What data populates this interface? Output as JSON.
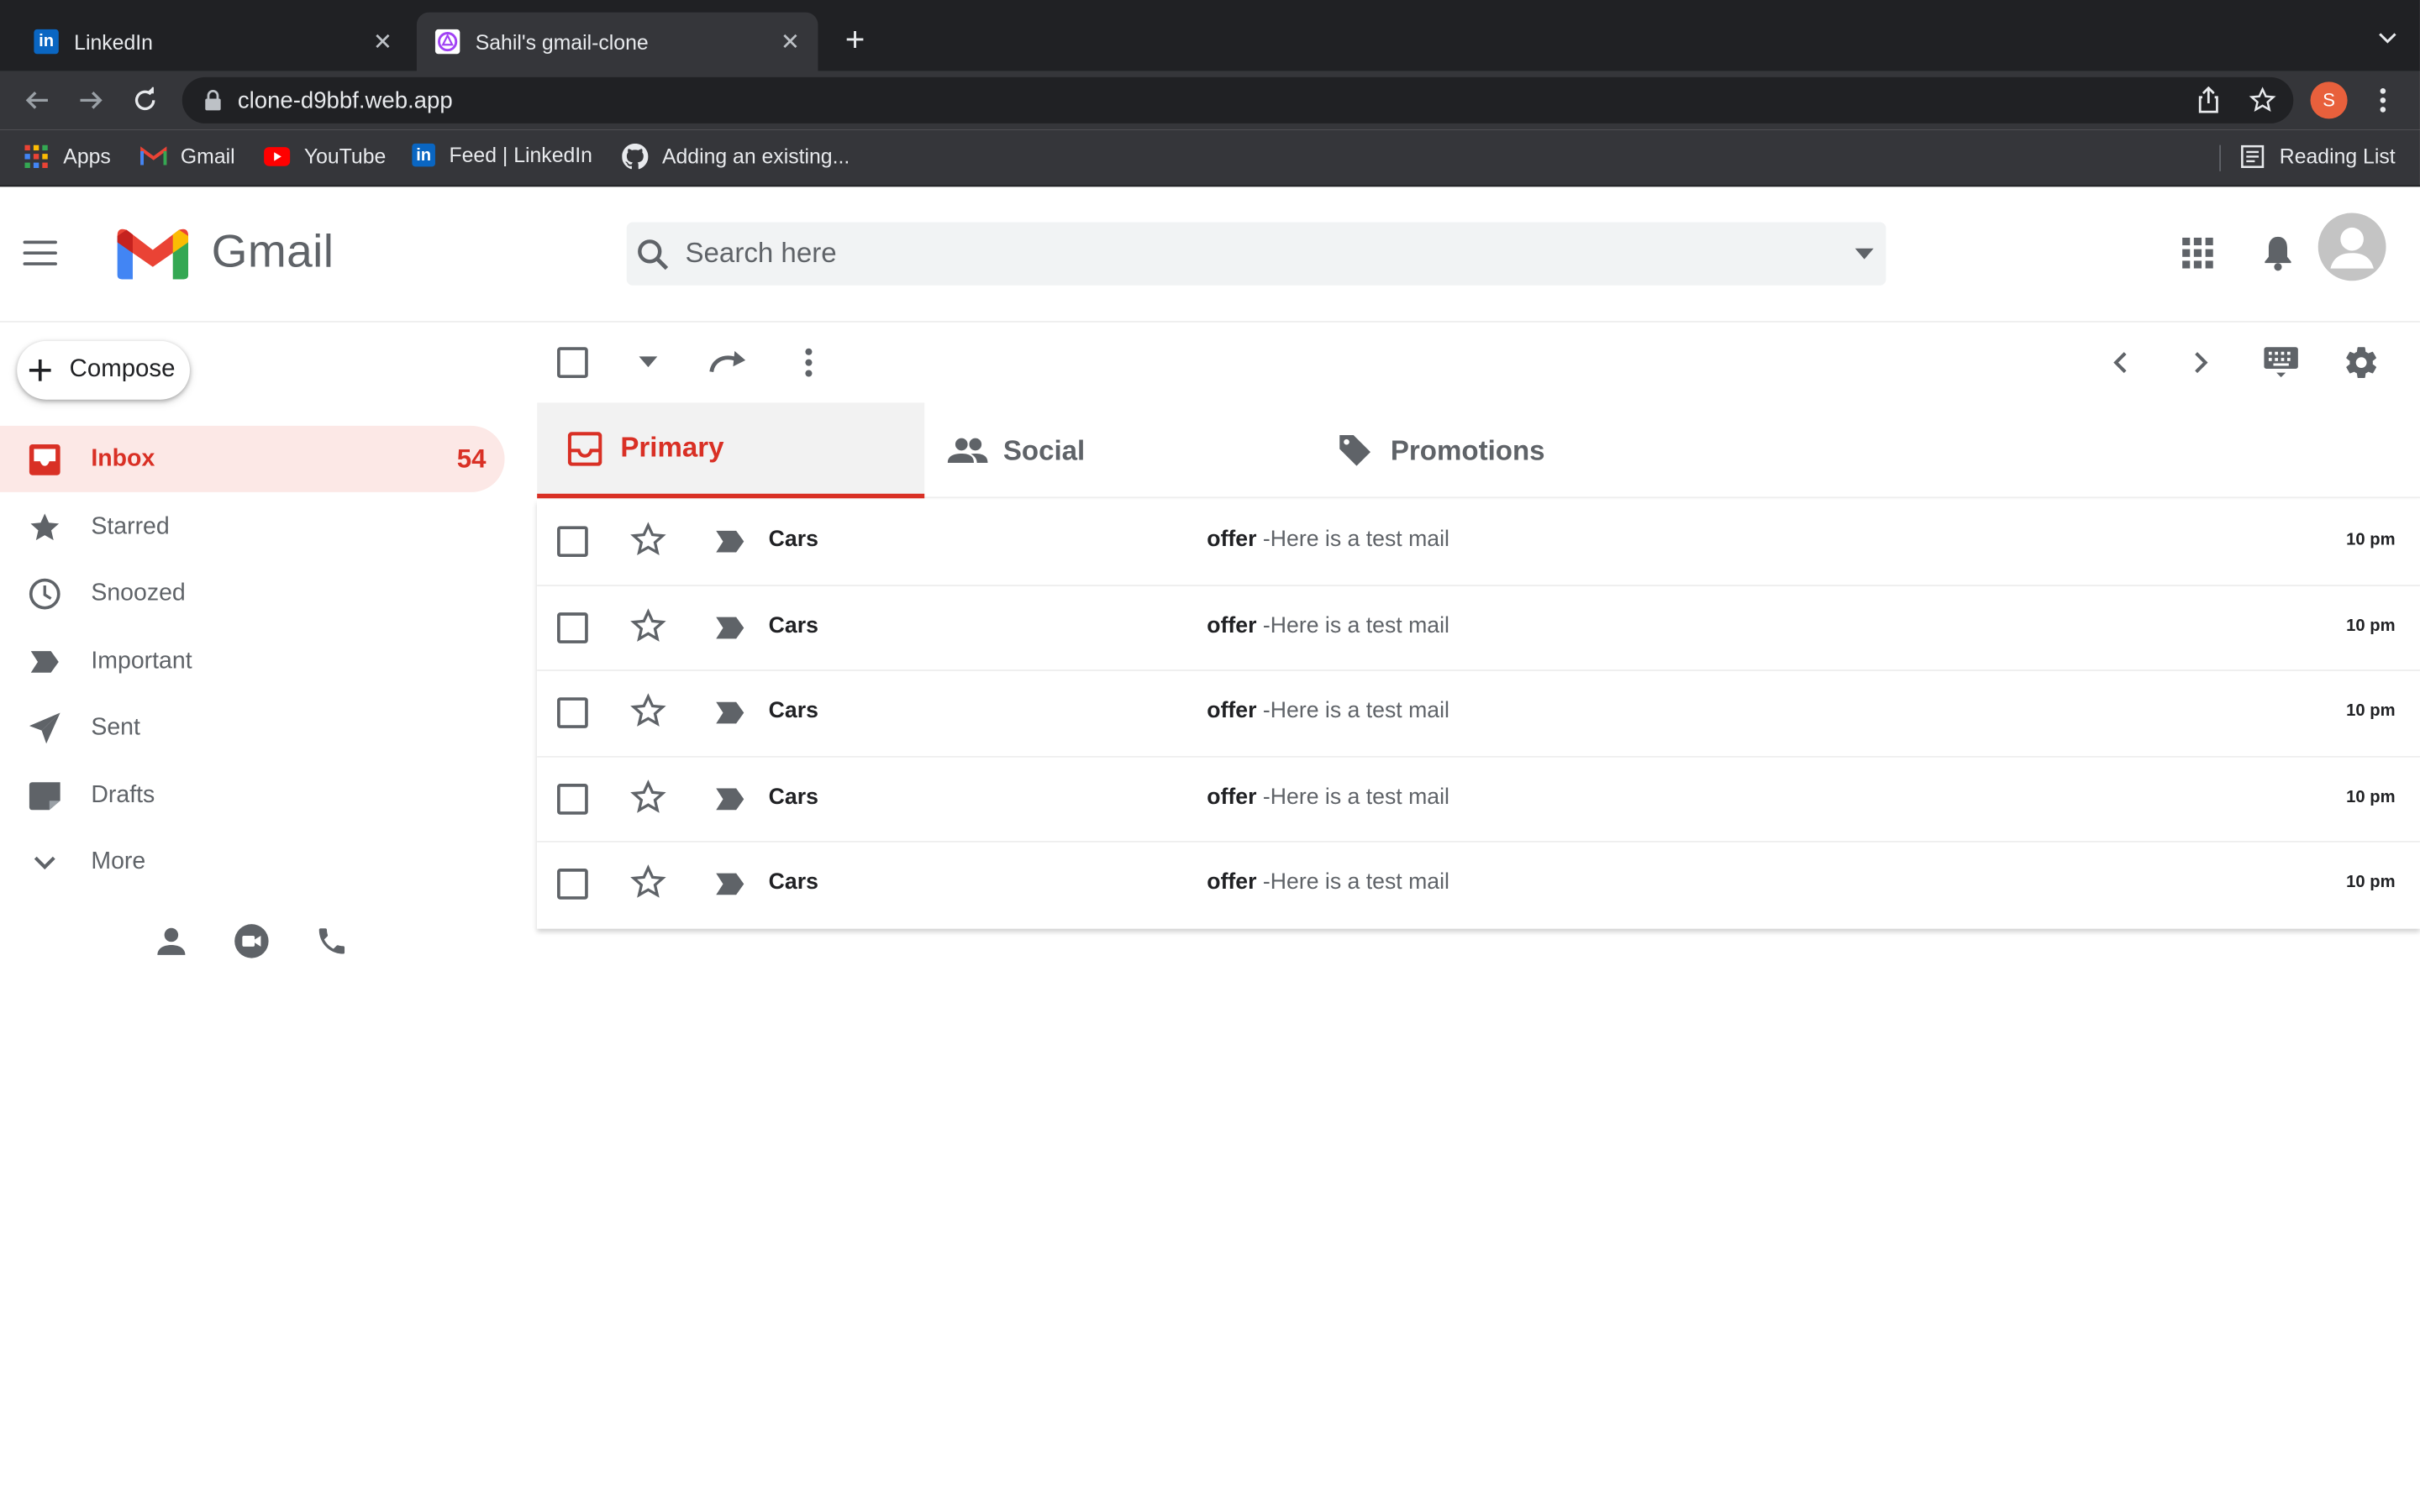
{
  "browser": {
    "tabs": [
      {
        "title": "LinkedIn",
        "active": false,
        "favicon": "linkedin-icon"
      },
      {
        "title": "Sahil's gmail-clone",
        "active": true,
        "favicon": "firebase-icon"
      }
    ],
    "url": "clone-d9bbf.web.app",
    "profile_initial": "S",
    "bookmarks": [
      {
        "label": "Apps",
        "icon": "apps-grid-icon"
      },
      {
        "label": "Gmail",
        "icon": "gmail-icon"
      },
      {
        "label": "YouTube",
        "icon": "youtube-icon"
      },
      {
        "label": "Feed | LinkedIn",
        "icon": "linkedin-icon"
      },
      {
        "label": "Adding an existing...",
        "icon": "github-icon"
      }
    ],
    "reading_list": "Reading List"
  },
  "header": {
    "brand": "Gmail",
    "search_placeholder": "Search here"
  },
  "sidebar": {
    "compose": "Compose",
    "items": [
      {
        "label": "Inbox",
        "count": "54",
        "active": true,
        "icon": "inbox-icon"
      },
      {
        "label": "Starred",
        "count": "",
        "icon": "star-icon"
      },
      {
        "label": "Snoozed",
        "count": "",
        "icon": "clock-icon"
      },
      {
        "label": "Important",
        "count": "",
        "icon": "label-important-icon"
      },
      {
        "label": "Sent",
        "count": "",
        "icon": "send-icon"
      },
      {
        "label": "Drafts",
        "count": "",
        "icon": "draft-icon"
      },
      {
        "label": "More",
        "count": "",
        "icon": "chevron-down-icon"
      }
    ]
  },
  "main": {
    "tabs": [
      {
        "label": "Primary",
        "active": true,
        "icon": "inbox-icon"
      },
      {
        "label": "Social",
        "active": false,
        "icon": "people-icon"
      },
      {
        "label": "Promotions",
        "active": false,
        "icon": "tag-icon"
      }
    ],
    "emails": [
      {
        "sender": "Cars",
        "subject": "offer",
        "snippet": "-Here is a test mail",
        "time": "10 pm"
      },
      {
        "sender": "Cars",
        "subject": "offer",
        "snippet": "-Here is a test mail",
        "time": "10 pm"
      },
      {
        "sender": "Cars",
        "subject": "offer",
        "snippet": "-Here is a test mail",
        "time": "10 pm"
      },
      {
        "sender": "Cars",
        "subject": "offer",
        "snippet": "-Here is a test mail",
        "time": "10 pm"
      },
      {
        "sender": "Cars",
        "subject": "offer",
        "snippet": "-Here is a test mail",
        "time": "10 pm"
      }
    ]
  },
  "colors": {
    "accent": "#d93025",
    "chrome_dark": "#202124",
    "chrome_toolbar": "#35363a",
    "active_nav_bg": "#fce8e6"
  }
}
